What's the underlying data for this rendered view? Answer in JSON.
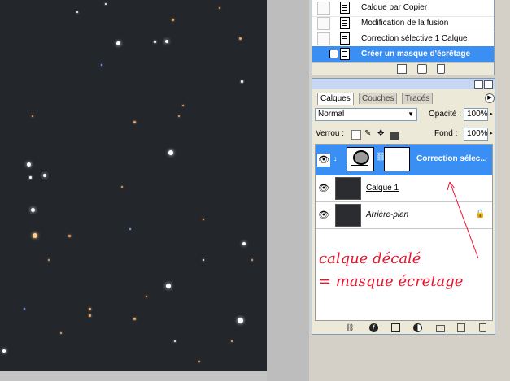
{
  "history": {
    "items": [
      {
        "label": "Calque par Copier",
        "selected": false
      },
      {
        "label": "Modification de la fusion",
        "selected": false
      },
      {
        "label": "Correction sélective 1 Calque",
        "selected": false
      },
      {
        "label": "Créer un masque d'écrêtage",
        "selected": true
      }
    ],
    "footer_icons": [
      "new-document-icon",
      "snapshot-icon",
      "trash-icon"
    ]
  },
  "layers_panel": {
    "tabs": [
      {
        "label": "Calques",
        "active": true
      },
      {
        "label": "Couches",
        "active": false
      },
      {
        "label": "Tracés",
        "active": false
      }
    ],
    "blend_mode": "Normal",
    "opacity_label": "Opacité :",
    "opacity_value": "100%",
    "lock_label": "Verrou :",
    "fill_label": "Fond :",
    "fill_value": "100%",
    "layers": [
      {
        "name": "Correction sélec...",
        "selected": true,
        "type": "adjustment"
      },
      {
        "name": "Calque 1",
        "selected": false,
        "type": "pixel"
      },
      {
        "name": "Arrière-plan",
        "selected": false,
        "type": "background",
        "locked": true
      }
    ],
    "footer_icons": [
      "link-icon",
      "fx-icon",
      "mask-icon",
      "adjustment-icon",
      "group-folder-icon",
      "new-layer-icon",
      "trash-icon"
    ]
  },
  "annotation": {
    "line1": "calque décalé",
    "line2": "= masque écretage",
    "color": "#e8132d"
  },
  "colors": {
    "selection": "#3a8ff5",
    "canvas": "#23262b"
  }
}
